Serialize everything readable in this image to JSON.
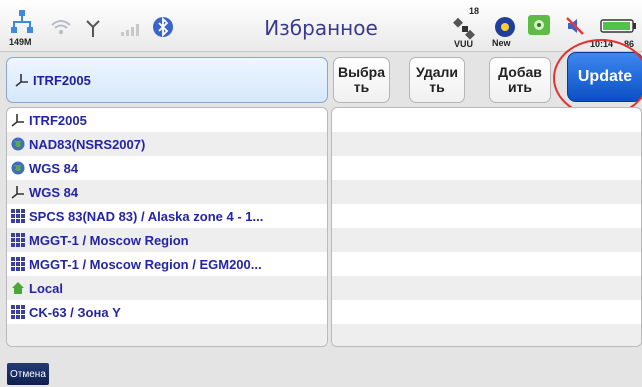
{
  "status_bar": {
    "title": "Избранное",
    "network_label": "149M",
    "sat_count": "18",
    "sat_label": "VUU",
    "new_label": "New",
    "time": "10:14",
    "battery": "86",
    "icons": [
      "network-icon",
      "wifi-icon",
      "antenna-icon",
      "signal-icon",
      "bluetooth-icon",
      "satellite-icon",
      "new-badge-icon",
      "gps-fix-icon",
      "speaker-muted-icon",
      "battery-icon"
    ]
  },
  "selected": {
    "value": "ITRF2005"
  },
  "toolbar": {
    "select_label": "Выбра\nть",
    "delete_label": "Удали\nть",
    "add_label": "Добав\nить",
    "update_label": "Update"
  },
  "list": {
    "items": [
      {
        "label": "ITRF2005",
        "icon": "geocentric-axes-icon"
      },
      {
        "label": "NAD83(NSRS2007)",
        "icon": "globe-icon"
      },
      {
        "label": "WGS 84",
        "icon": "globe-icon"
      },
      {
        "label": "WGS 84",
        "icon": "geocentric-axes-icon"
      },
      {
        "label": "SPCS 83(NAD 83) / Alaska zone 4 - 1...",
        "icon": "grid-icon"
      },
      {
        "label": "MGGT-1 / Moscow Region",
        "icon": "grid-icon"
      },
      {
        "label": "MGGT-1 / Moscow Region / EGM200...",
        "icon": "grid-icon"
      },
      {
        "label": "Local",
        "icon": "house-icon"
      },
      {
        "label": "CK-63 / Зона Y",
        "icon": "grid-icon"
      }
    ]
  },
  "footer": {
    "cancel_label": "Отмена"
  },
  "colors": {
    "accent": "#1a5fd6",
    "list_text": "#2424a8",
    "highlight_ring": "#e53030"
  }
}
